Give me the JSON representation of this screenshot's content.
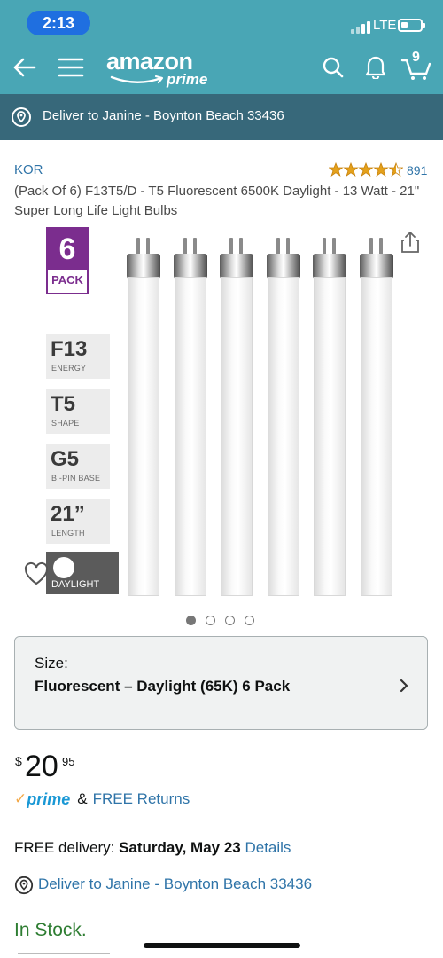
{
  "status_bar": {
    "time": "2:13",
    "network": "LTE"
  },
  "header": {
    "logo": "amazon",
    "logo_sub": "prime",
    "cart_count": "9",
    "icons": [
      "back-arrow-icon",
      "menu-icon",
      "search-icon",
      "bell-icon",
      "cart-icon"
    ]
  },
  "deliver_bar": {
    "text": "Deliver to Janine - Boynton Beach 33436"
  },
  "product": {
    "brand": "KOR",
    "rating_count": "891",
    "rating": 4.5,
    "title": "(Pack Of 6) F13T5/D - T5 Fluorescent 6500K Daylight - 13 Watt - 21\" Super Long Life Light Bulbs"
  },
  "image": {
    "pack_number": "6",
    "pack_label": "PACK",
    "specs": [
      {
        "big": "F13",
        "small": "ENERGY"
      },
      {
        "big": "T5",
        "small": "SHAPE"
      },
      {
        "big": "G5",
        "small": "BI-PIN BASE"
      },
      {
        "big": "21”",
        "small": "LENGTH"
      }
    ],
    "daylight_label": "DAYLIGHT",
    "bulb_count": 6,
    "carousel_pages": 4,
    "carousel_active": 1
  },
  "size": {
    "label": "Size:",
    "value": "Fluorescent – Daylight (65K) 6 Pack"
  },
  "price": {
    "currency": "$",
    "whole": "20",
    "fraction": "95"
  },
  "prime_line": {
    "prime": "prime",
    "amp": "&",
    "free_returns": "FREE Returns"
  },
  "delivery": {
    "prefix": "FREE delivery: ",
    "date": "Saturday, May 23",
    "details": "Details"
  },
  "deliver_to": "Deliver to Janine - Boynton Beach 33436",
  "stock": "In Stock.",
  "colors": {
    "header": "#49a6b5",
    "deliver_bar": "#37687a",
    "link": "#2f74a8",
    "in_stock": "#2e7d32",
    "star": "#e4a11b",
    "pack_purple": "#7b2d8e",
    "time_pill": "#1f6fe0"
  }
}
